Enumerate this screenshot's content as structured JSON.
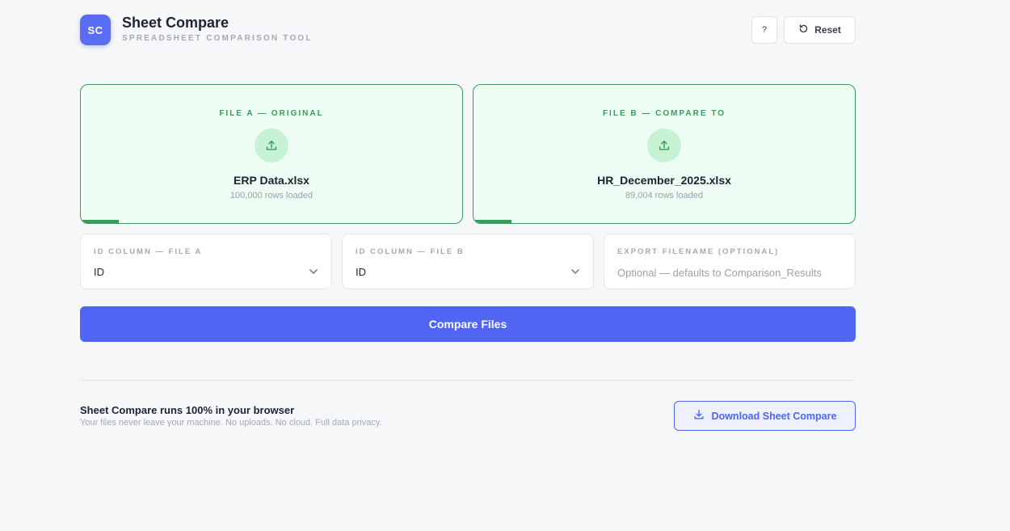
{
  "header": {
    "logo_text": "SC",
    "title": "Sheet Compare",
    "subtitle": "SPREADSHEET COMPARISON TOOL",
    "help_label": "?",
    "reset_label": "Reset",
    "reset_icon": "refresh-icon"
  },
  "files": {
    "a": {
      "label": "FILE A — ORIGINAL",
      "filename": "ERP Data.xlsx",
      "rows": "100,000 rows loaded",
      "icon": "upload-icon",
      "progress": 0.1
    },
    "b": {
      "label": "FILE B — COMPARE TO",
      "filename": "HR_December_2025.xlsx",
      "rows": "89,004 rows loaded",
      "icon": "upload-icon",
      "progress": 0.1
    }
  },
  "options": {
    "id_a": {
      "label": "ID COLUMN — FILE A",
      "value": "ID"
    },
    "id_b": {
      "label": "ID COLUMN — FILE B",
      "value": "ID"
    },
    "export": {
      "label": "EXPORT FILENAME (OPTIONAL)",
      "value": "",
      "placeholder": "Optional — defaults to Comparison_Results"
    }
  },
  "compare_label": "Compare Files",
  "footer": {
    "title": "Sheet Compare runs 100% in your browser",
    "subtitle": "Your files never leave your machine. No uploads. No cloud. Full data privacy.",
    "download_label": "Download Sheet Compare",
    "download_icon": "download-icon"
  },
  "colors": {
    "accent": "#5066f2",
    "success": "#3d9a5c",
    "card_bg": "#edfdf3",
    "page_bg": "#f6f7f9"
  }
}
